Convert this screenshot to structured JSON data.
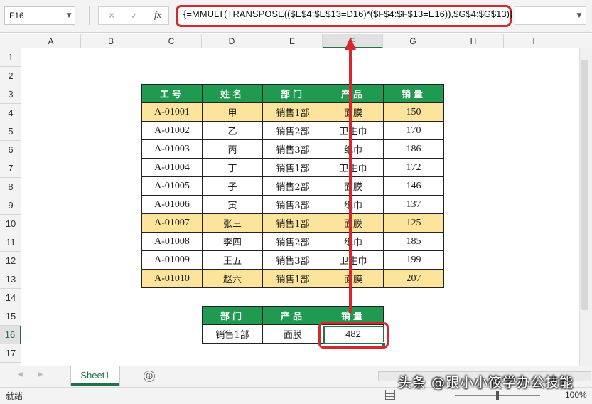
{
  "name_box": {
    "value": "F16"
  },
  "formula_bar": {
    "cancel_glyph": "✕",
    "enter_glyph": "✓",
    "fx_label": "fx",
    "formula": "{=MMULT(TRANSPOSE(($E$4:$E$13=D16)*($F$4:$F$13=E16)),$G$4:$G$13)}"
  },
  "grid": {
    "selected_cell": "F16",
    "columns": [
      "A",
      "B",
      "C",
      "D",
      "E",
      "F",
      "G",
      "H",
      "I"
    ],
    "rows": [
      "1",
      "2",
      "3",
      "4",
      "5",
      "6",
      "7",
      "8",
      "9",
      "10",
      "11",
      "12",
      "13",
      "14",
      "15",
      "16",
      "17"
    ]
  },
  "main_table": {
    "headers": [
      "工号",
      "姓名",
      "部门",
      "产品",
      "销量"
    ],
    "rows": [
      {
        "id": "A-01001",
        "name": "甲",
        "dept": "销售1部",
        "product": "面膜",
        "sales": "150",
        "highlight": true
      },
      {
        "id": "A-01002",
        "name": "乙",
        "dept": "销售2部",
        "product": "卫生巾",
        "sales": "170",
        "highlight": false
      },
      {
        "id": "A-01003",
        "name": "丙",
        "dept": "销售3部",
        "product": "纸巾",
        "sales": "186",
        "highlight": false
      },
      {
        "id": "A-01004",
        "name": "丁",
        "dept": "销售1部",
        "product": "卫生巾",
        "sales": "172",
        "highlight": false
      },
      {
        "id": "A-01005",
        "name": "子",
        "dept": "销售2部",
        "product": "面膜",
        "sales": "146",
        "highlight": false
      },
      {
        "id": "A-01006",
        "name": "寅",
        "dept": "销售3部",
        "product": "纸巾",
        "sales": "137",
        "highlight": false
      },
      {
        "id": "A-01007",
        "name": "张三",
        "dept": "销售1部",
        "product": "面膜",
        "sales": "125",
        "highlight": true
      },
      {
        "id": "A-01008",
        "name": "李四",
        "dept": "销售2部",
        "product": "纸巾",
        "sales": "185",
        "highlight": false
      },
      {
        "id": "A-01009",
        "name": "王五",
        "dept": "销售3部",
        "product": "卫生巾",
        "sales": "199",
        "highlight": false
      },
      {
        "id": "A-01010",
        "name": "赵六",
        "dept": "销售1部",
        "product": "面膜",
        "sales": "207",
        "highlight": true
      }
    ]
  },
  "lookup_table": {
    "headers": [
      "部门",
      "产品",
      "销量"
    ],
    "row": {
      "dept": "销售1部",
      "product": "面膜",
      "sales": "482"
    }
  },
  "sheet_tabs": [
    {
      "label": "Sheet1",
      "active": true
    }
  ],
  "add_sheet_glyph": "⊕",
  "status_bar": {
    "status": "就绪",
    "zoom": "100%"
  },
  "watermark": "头条 @跟小小筱学办公技能",
  "colors": {
    "header_green": "#1f9a50",
    "highlight_yellow": "#fde49c",
    "callout_red": "#d6272d",
    "excel_green": "#217346"
  }
}
